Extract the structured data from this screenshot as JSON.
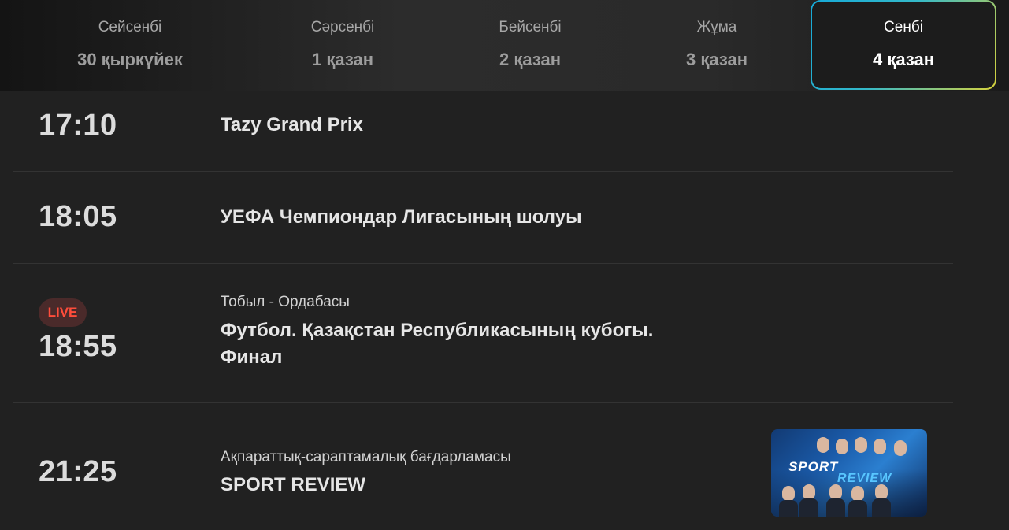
{
  "days": [
    {
      "name": "Сейсенбі",
      "date": "30 қыркүйек"
    },
    {
      "name": "Сәрсенбі",
      "date": "1 қазан"
    },
    {
      "name": "Бейсенбі",
      "date": "2 қазан"
    },
    {
      "name": "Жұма",
      "date": "3 қазан"
    },
    {
      "name": "Сенбі",
      "date": "4 қазан",
      "active": true
    }
  ],
  "schedule": [
    {
      "time": "17:10",
      "title": "Tazy Grand Prix"
    },
    {
      "time": "18:05",
      "title": "УЕФА Чемпиондар Лигасының шолуы"
    },
    {
      "time": "18:55",
      "live_label": "LIVE",
      "subtitle": "Тобыл - Ордабасы",
      "title_line1": "Футбол. Қазақстан Республикасының кубогы.",
      "title_line2": "Финал"
    },
    {
      "time": "21:25",
      "subtitle": "Ақпараттық-сараптамалық бағдарламасы",
      "title": "SPORT REVIEW",
      "thumb_text1": "SPORT",
      "thumb_text2": "REVIEW"
    }
  ],
  "colors": {
    "live": "#ff4d3b",
    "active_border_start": "#16a9d8",
    "active_border_end": "#d8d23a"
  }
}
